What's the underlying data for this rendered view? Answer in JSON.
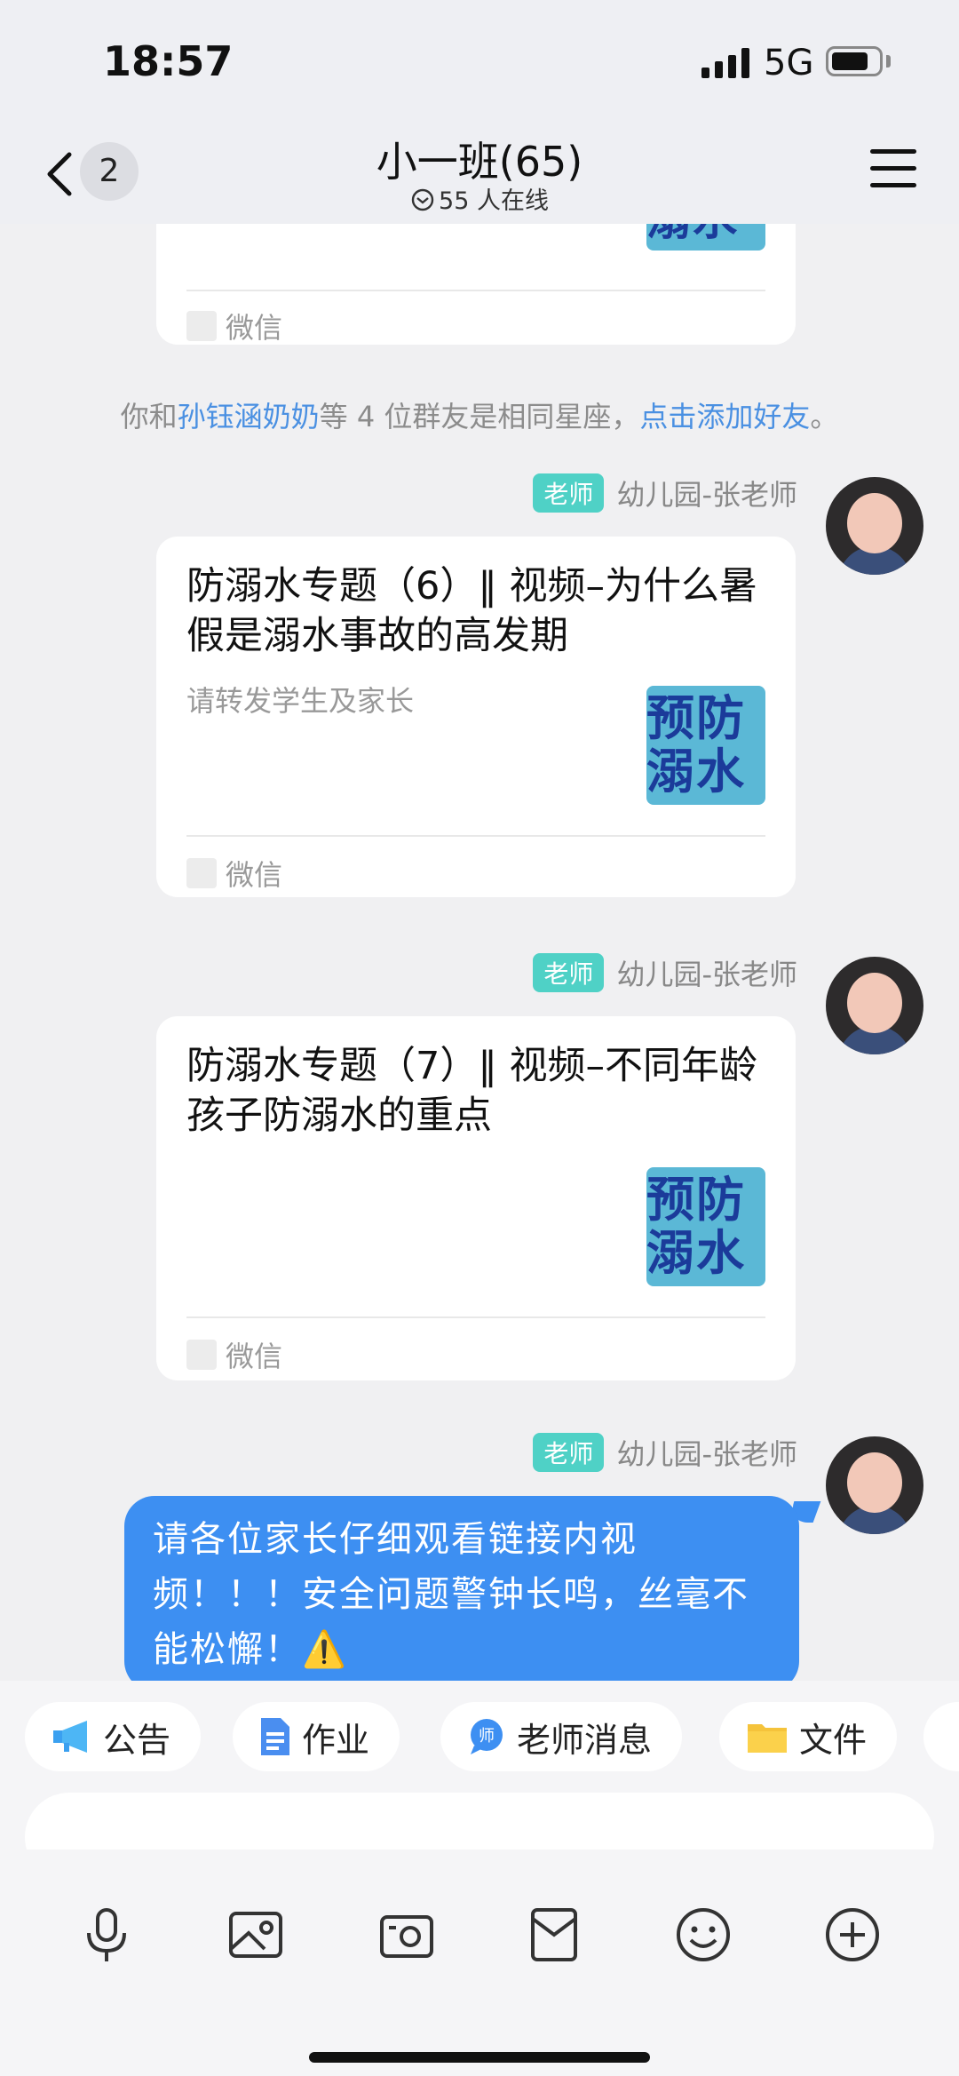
{
  "status_bar": {
    "time": "18:57",
    "network": "5G"
  },
  "header": {
    "unread_count": "2",
    "title": "小一班(65)",
    "online_text": "55 人在线"
  },
  "messages": {
    "card0": {
      "source": "微信"
    },
    "system": {
      "prefix": "你和",
      "name": "孙钰涵奶奶",
      "middle": "等 4 位群友是相同星座，",
      "link": "点击添加好友",
      "suffix": "。"
    },
    "card1": {
      "role": "老师",
      "sender": "幼儿园-张老师",
      "title": "防溺水专题（6）‖ 视频–为什么暑假是溺水事故的高发期",
      "desc": "请转发学生及家长",
      "thumb_text": "预防溺水",
      "source": "微信"
    },
    "card2": {
      "role": "老师",
      "sender": "幼儿园-张老师",
      "title": "防溺水专题（7）‖ 视频–不同年龄孩子防溺水的重点",
      "thumb_text": "预防溺水",
      "source": "微信"
    },
    "text_msg": {
      "role": "老师",
      "sender": "幼儿园-张老师",
      "text": "请各位家长仔细观看链接内视频！！！安全问题警钟长鸣，丝毫不能松懈！⚠️"
    }
  },
  "quick_actions": [
    "公告",
    "作业",
    "老师消息",
    "文件"
  ],
  "input": {
    "placeholder": ""
  },
  "toolbar_icons": [
    "microphone-icon",
    "image-icon",
    "camera-icon",
    "red-packet-icon",
    "emoji-icon",
    "plus-icon"
  ]
}
